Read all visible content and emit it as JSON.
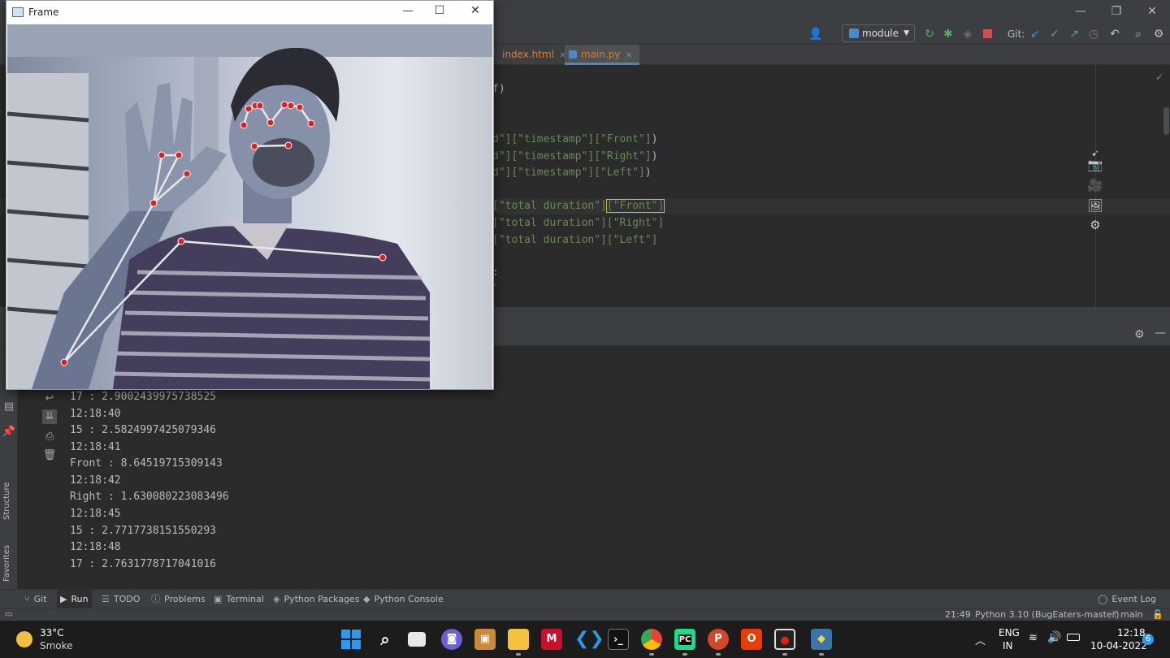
{
  "ide": {
    "window_controls": {
      "minimize": "—",
      "maximize": "❐",
      "close": "✕"
    },
    "toolbar": {
      "run_config": "module",
      "git_label": "Git:"
    },
    "tabs": [
      {
        "label": "index.html",
        "close": "×"
      },
      {
        "label": "main.py",
        "close": "×"
      }
    ],
    "code_lines": [
      {
        "prefix": "f)",
        "parts": []
      },
      {
        "prefix": "d\"]",
        "str1": "[\"timestamp\"]",
        "str2": "[\"Front\"]",
        "suffix": ")"
      },
      {
        "prefix": "d\"]",
        "str1": "[\"timestamp\"]",
        "str2": "[\"Right\"]",
        "suffix": ")"
      },
      {
        "prefix": "d\"]",
        "str1": "[\"timestamp\"]",
        "str2": "[\"Left\"]",
        "suffix": ")"
      },
      {
        "prefix": "",
        "str1": "[\"total duration\"]",
        "str2": "[\"Front\"]",
        "suffix": ""
      },
      {
        "prefix": "",
        "str1": "[\"total duration\"]",
        "str2": "[\"Right\"]",
        "suffix": ""
      },
      {
        "prefix": "",
        "str1": "[\"total duration\"]",
        "str2": "[\"Left\"]",
        "suffix": ""
      },
      {
        "prefix": ":",
        "parts": []
      },
      {
        "prefix": "'",
        "parts": []
      }
    ],
    "run_output": [
      "17 : 2.9002439975738525",
      "12:18:40",
      "15 : 2.5824997425079346",
      "12:18:41",
      "Front : 8.64519715309143",
      "12:18:42",
      "Right : 1.630080223083496",
      "12:18:45",
      "15 : 2.7717738151550293",
      "12:18:48",
      "17 : 2.7631778717041016"
    ],
    "left_labels": {
      "structure": "Structure",
      "favorites": "Favorites"
    },
    "tool_tabs": {
      "git": "Git",
      "run": "Run",
      "todo": "TODO",
      "problems": "Problems",
      "terminal": "Terminal",
      "python_packages": "Python Packages",
      "python_console": "Python Console",
      "event_log": "Event Log"
    },
    "status": {
      "position": "21:49",
      "interpreter": "Python 3.10 (BugEaters-master)",
      "branch": "main"
    }
  },
  "frame_window": {
    "title": "Frame",
    "controls": {
      "minimize": "—",
      "maximize": "☐",
      "close": "✕"
    }
  },
  "taskbar": {
    "weather": {
      "temp": "33°C",
      "condition": "Smoke"
    },
    "language": {
      "lang": "ENG",
      "region": "IN"
    },
    "clock": {
      "time": "12:18",
      "date": "10-04-2022"
    },
    "notification_count": "6"
  },
  "colors": {
    "ide_bg": "#2b2b2b",
    "panel_bg": "#3c3f41",
    "string_green": "#6a8759",
    "landmark_red": "#e02020",
    "taskbar_bg": "#1c1c1c"
  }
}
